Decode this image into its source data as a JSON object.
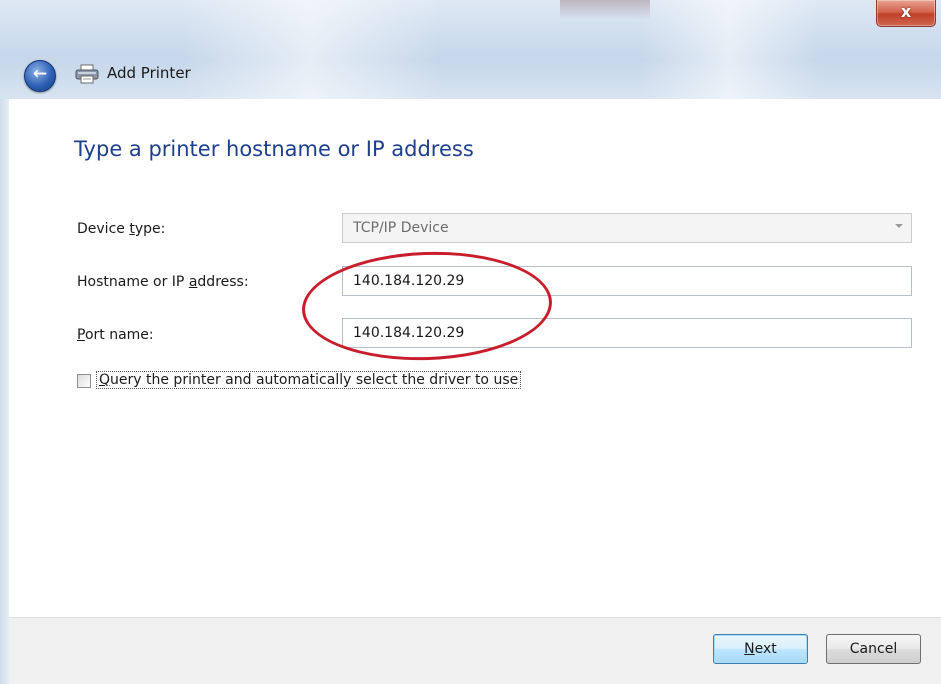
{
  "window": {
    "title": "Add Printer",
    "close_symbol": "x",
    "back_symbol": "←"
  },
  "page": {
    "title": "Type a printer hostname or IP address"
  },
  "form": {
    "device_type": {
      "label_pre": "Device ",
      "label_u": "t",
      "label_post": "ype:",
      "value": "TCP/IP Device"
    },
    "hostname": {
      "label_pre": "Hostname or IP ",
      "label_u": "a",
      "label_post": "ddress:",
      "value": "140.184.120.29"
    },
    "port": {
      "label_pre": "",
      "label_u": "P",
      "label_post": "ort name:",
      "value": "140.184.120.29"
    },
    "query_checkbox": {
      "checked": false,
      "label_u": "Q",
      "label_post": "uery the printer and automatically select the driver to use"
    }
  },
  "footer": {
    "next_u": "N",
    "next_post": "ext",
    "cancel_label": "Cancel"
  },
  "colors": {
    "title_blue": "#1e3f8c",
    "annotation_red": "#c81e2c"
  },
  "icons": {
    "back": "back-arrow-icon",
    "printer": "printer-icon",
    "close": "close-icon",
    "dropdown": "chevron-down-icon"
  }
}
